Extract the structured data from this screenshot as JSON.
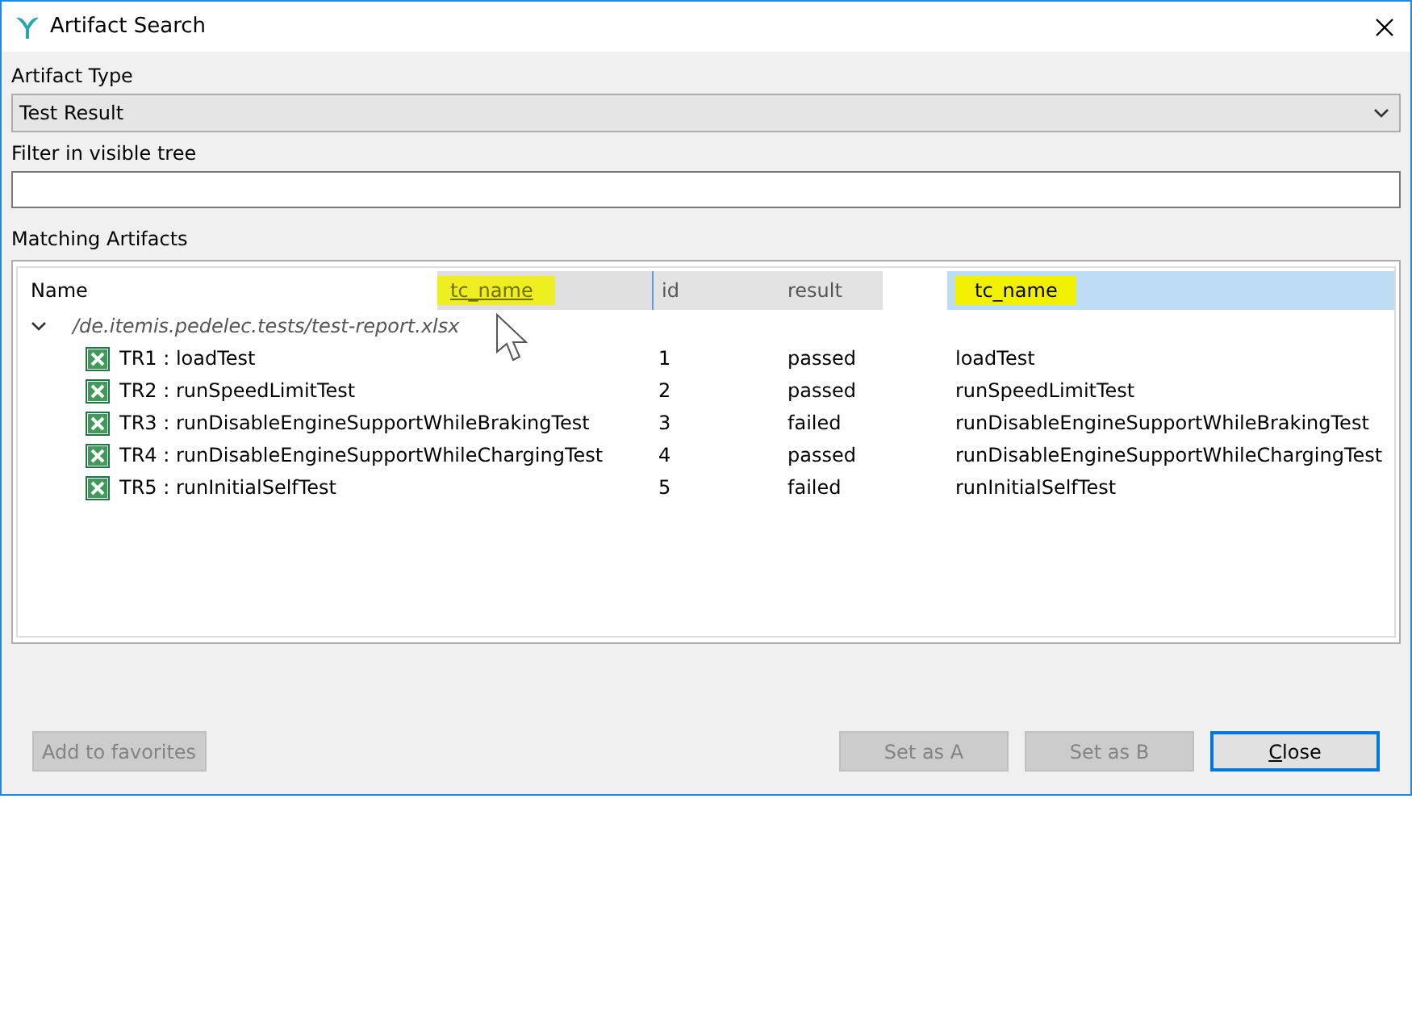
{
  "window": {
    "title": "Artifact Search"
  },
  "artifact_type": {
    "label": "Artifact Type",
    "value": "Test Result"
  },
  "filter": {
    "label": "Filter in visible tree"
  },
  "matching": {
    "label": "Matching Artifacts",
    "columns": [
      {
        "label": "Name",
        "selected": false,
        "highlighted": false
      },
      {
        "label": "id",
        "selected": false,
        "highlighted": false
      },
      {
        "label": "result",
        "selected": false,
        "highlighted": false
      },
      {
        "label": "tc_name",
        "selected": true,
        "highlighted": true
      }
    ],
    "dragged_column": {
      "label": "tc_name",
      "highlighted": true
    },
    "tree": [
      {
        "label": "/de.itemis.pedelec.tests/test-report.xlsx",
        "expanded": true,
        "children": [
          {
            "name": "TR1 : loadTest",
            "id": "1",
            "result": "passed",
            "tc_name": "loadTest"
          },
          {
            "name": "TR2 : runSpeedLimitTest",
            "id": "2",
            "result": "passed",
            "tc_name": "runSpeedLimitTest"
          },
          {
            "name": "TR3 : runDisableEngineSupportWhileBrakingTest",
            "id": "3",
            "result": "failed",
            "tc_name": "runDisableEngineSupportWhileBrakingTest"
          },
          {
            "name": "TR4 : runDisableEngineSupportWhileChargingTest",
            "id": "4",
            "result": "passed",
            "tc_name": "runDisableEngineSupportWhileChargingTest"
          },
          {
            "name": "TR5 : runInitialSelfTest",
            "id": "5",
            "result": "failed",
            "tc_name": "runInitialSelfTest"
          }
        ]
      }
    ]
  },
  "left_buttons": [
    {
      "label": "Add to favorites",
      "disabled": true
    }
  ],
  "right_buttons": [
    {
      "label": "Set as A",
      "disabled": true
    },
    {
      "label": "Set as B",
      "disabled": true
    },
    {
      "label": "Close",
      "disabled": false
    }
  ]
}
